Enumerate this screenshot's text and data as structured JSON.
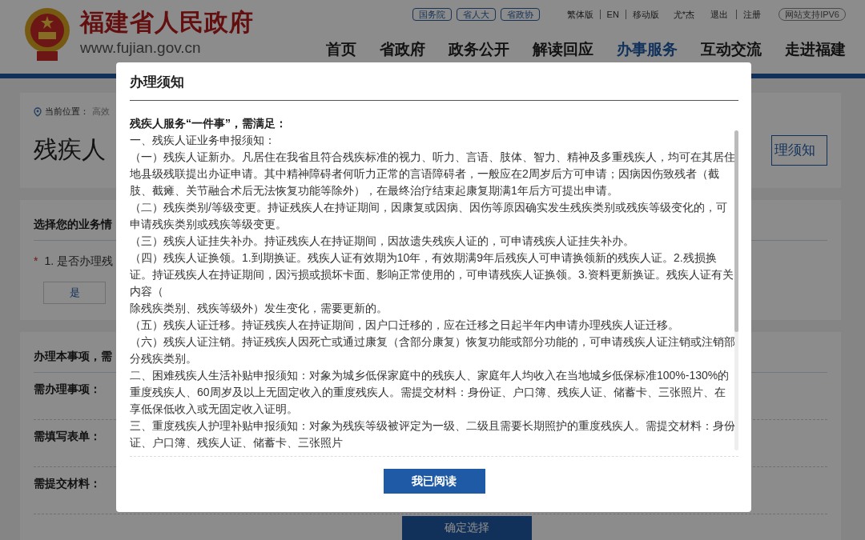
{
  "header": {
    "site_title": "福建省人民政府",
    "site_url": "www.fujian.gov.cn",
    "top_pills": [
      "国务院",
      "省人大",
      "省政协"
    ],
    "top_links": [
      "繁体版",
      "EN",
      "移动版"
    ],
    "user_name": "尤*杰",
    "logout": "退出",
    "register": "注册",
    "ipv6_badge": "网站支持IPV6",
    "nav": [
      {
        "label": "首页",
        "selected": false
      },
      {
        "label": "省政府",
        "selected": false
      },
      {
        "label": "政务公开",
        "selected": false
      },
      {
        "label": "解读回应",
        "selected": false
      },
      {
        "label": "办事服务",
        "selected": true
      },
      {
        "label": "互动交流",
        "selected": false
      },
      {
        "label": "走进福建",
        "selected": false
      }
    ]
  },
  "page": {
    "breadcrumb_label": "当前位置：",
    "breadcrumb_path": "高效",
    "title": "残疾人",
    "notice_button": "理须知",
    "section1_title": "选择您的业务情",
    "required_mark": "*",
    "question": "1. 是否办理残",
    "answer_button": "是",
    "section2_title": "办理本事项，需",
    "fields": [
      "需办理事项：",
      "需填写表单：",
      "需提交材料："
    ],
    "confirm_button": "确定选择"
  },
  "modal": {
    "title": "办理须知",
    "paragraphs": [
      {
        "kind": "heading",
        "text": "残疾人服务“一件事”，需满足："
      },
      {
        "kind": "text",
        "text": "一、残疾人证业务申报须知："
      },
      {
        "kind": "text",
        "text": "（一）残疾人证新办。凡居住在我省且符合残疾标准的视力、听力、言语、肢体、智力、精神及多重残疾人，均可在其居住地县级残联提出办证申请。其中精神障碍者何听力正常的言语障碍者，一般应在2周岁后方可申请；因病因伤致残者（截肢、截瘫、关节融合术后无法恢复功能等除外），在最终治疗结束起康复期满1年后方可提出申请。"
      },
      {
        "kind": "text",
        "text": "（二）残疾类别/等级变更。持证残疾人在持证期间，因康复或因病、因伤等原因确实发生残疾类别或残疾等级变化的，可申请残疾类别或残疾等级变更。"
      },
      {
        "kind": "text",
        "text": "（三）残疾人证挂失补办。持证残疾人在持证期间，因故遗失残疾人证的，可申请残疾人证挂失补办。"
      },
      {
        "kind": "text",
        "text": "（四）残疾人证换领。1.到期换证。残疾人证有效期为10年，有效期满9年后残疾人可申请换领新的残疾人证。2.残损换证。持证残疾人在持证期间，因污损或损坏卡面、影响正常使用的，可申请残疾人证换领。3.资料更新换证。残疾人证有关内容（"
      },
      {
        "kind": "text",
        "text": "除残疾类别、残疾等级外）发生变化，需要更新的。"
      },
      {
        "kind": "text",
        "text": "（五）残疾人证迁移。持证残疾人在持证期间，因户口迁移的，应在迁移之日起半年内申请办理残疾人证迁移。"
      },
      {
        "kind": "text",
        "text": "（六）残疾人证注销。持证残疾人因死亡或通过康复（含部分康复）恢复功能或部分功能的，可申请残疾人证注销或注销部分残疾类别。"
      },
      {
        "kind": "text",
        "text": "二、困难残疾人生活补贴申报须知：对象为城乡低保家庭中的残疾人、家庭年人均收入在当地城乡低保标准100%-130%的重度残疾人、60周岁及以上无固定收入的重度残疾人。需提交材料：身份证、户口簿、残疾人证、储蓄卡、三张照片、在享低保低收入或无固定收入证明。"
      },
      {
        "kind": "text",
        "text": "三、重度残疾人护理补贴申报须知：对象为残疾等级被评定为一级、二级且需要长期照护的重度残疾人。需提交材料：身份证、户口簿、残疾人证、储蓄卡、三张照片"
      }
    ],
    "confirm_button": "我已阅读"
  }
}
